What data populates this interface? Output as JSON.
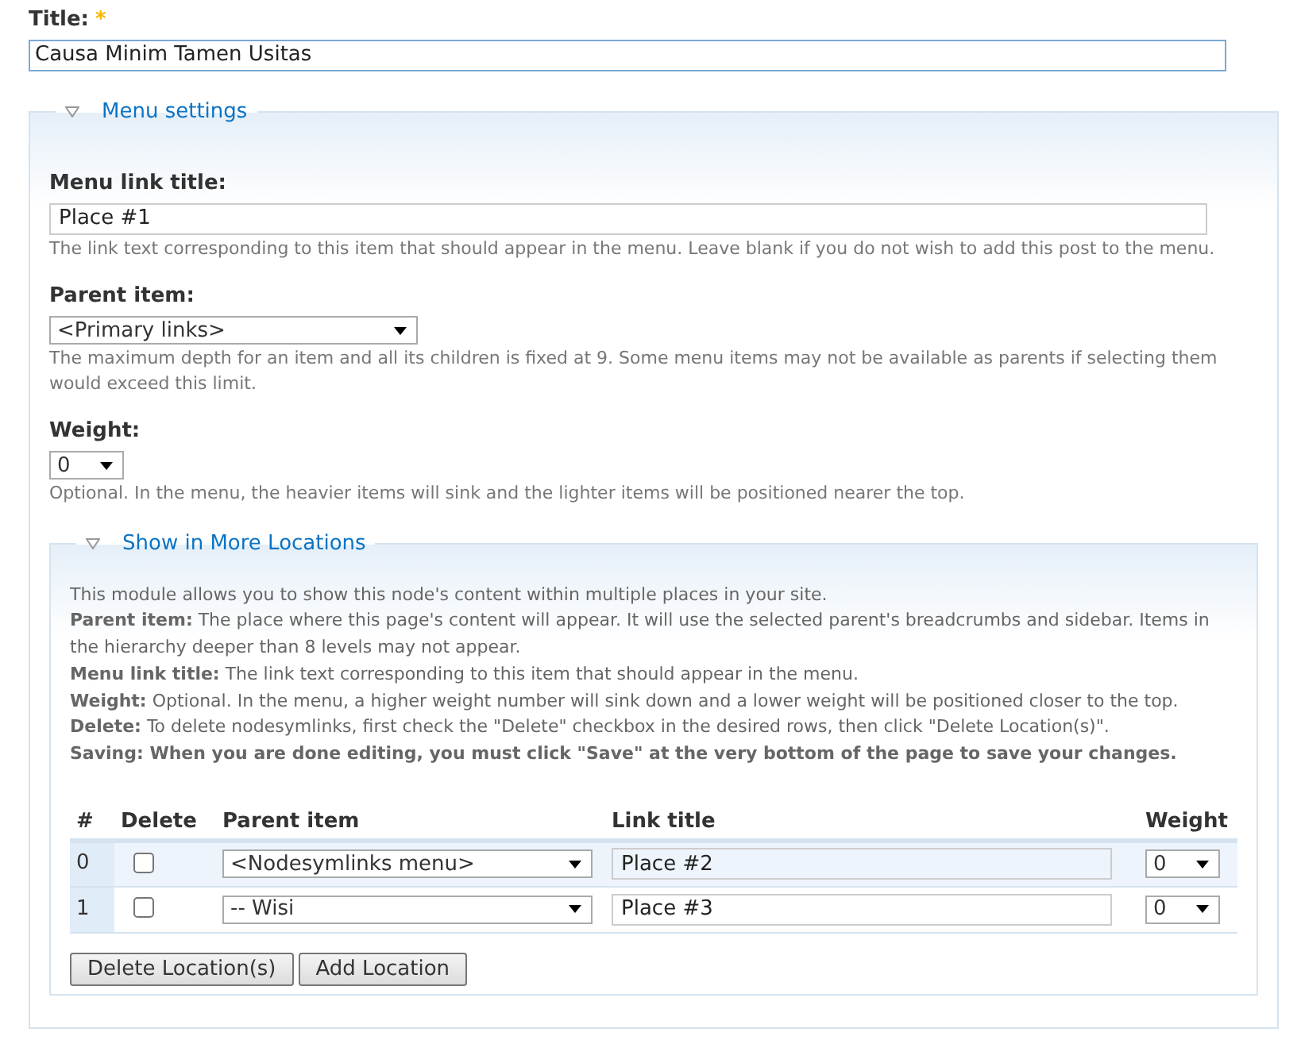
{
  "title_field": {
    "label": "Title:",
    "required_mark": "*",
    "value": "Causa Minim Tamen Usitas"
  },
  "menu_settings": {
    "legend": "Menu settings",
    "expanded": true,
    "link_title": {
      "label": "Menu link title:",
      "value": "Place #1",
      "description": "The link text corresponding to this item that should appear in the menu. Leave blank if you do not wish to add this post to the menu."
    },
    "parent_item": {
      "label": "Parent item:",
      "value": "<Primary links>",
      "description": "The maximum depth for an item and all its children is fixed at 9. Some menu items may not be available as parents if selecting them would exceed this limit."
    },
    "weight": {
      "label": "Weight:",
      "value": "0",
      "description": "Optional. In the menu, the heavier items will sink and the lighter items will be positioned nearer the top."
    },
    "more_locations": {
      "legend": "Show in More Locations",
      "expanded": true,
      "help": [
        {
          "kind": "plain",
          "text": "This module allows you to show this node's content within multiple places in your site."
        },
        {
          "kind": "plain",
          "text": "**Parent item:** The place where this page's content will appear. It will use the selected parent's breadcrumbs and sidebar. Items in the hierarchy deeper than 8 levels may not appear."
        },
        {
          "kind": "plain",
          "text": "**Menu link title:** The link text corresponding to this item that should appear in the menu."
        },
        {
          "kind": "plain",
          "text": "**Weight:** Optional. In the menu, a higher weight number will sink down and a lower weight will be positioned closer to the top."
        },
        {
          "kind": "plain",
          "text": "**Delete:** To delete nodesymlinks, first check the \"Delete\" checkbox in the desired rows, then click \"Delete Location(s)\"."
        },
        {
          "kind": "strong",
          "text": "Saving: When you are done editing, you must click \"Save\" at the very bottom of the page to save your changes."
        }
      ],
      "table": {
        "columns": [
          "#",
          "Delete",
          "Parent item",
          "Link title",
          "Weight"
        ],
        "rows": [
          {
            "index": "0",
            "checked": false,
            "parent": "<Nodesymlinks menu>",
            "link_title": "Place #2",
            "weight": "0"
          },
          {
            "index": "1",
            "checked": false,
            "parent": "-- Wisi",
            "link_title": "Place #3",
            "weight": "0"
          }
        ]
      },
      "buttons": [
        "Delete Location(s)",
        "Add Location"
      ]
    }
  }
}
